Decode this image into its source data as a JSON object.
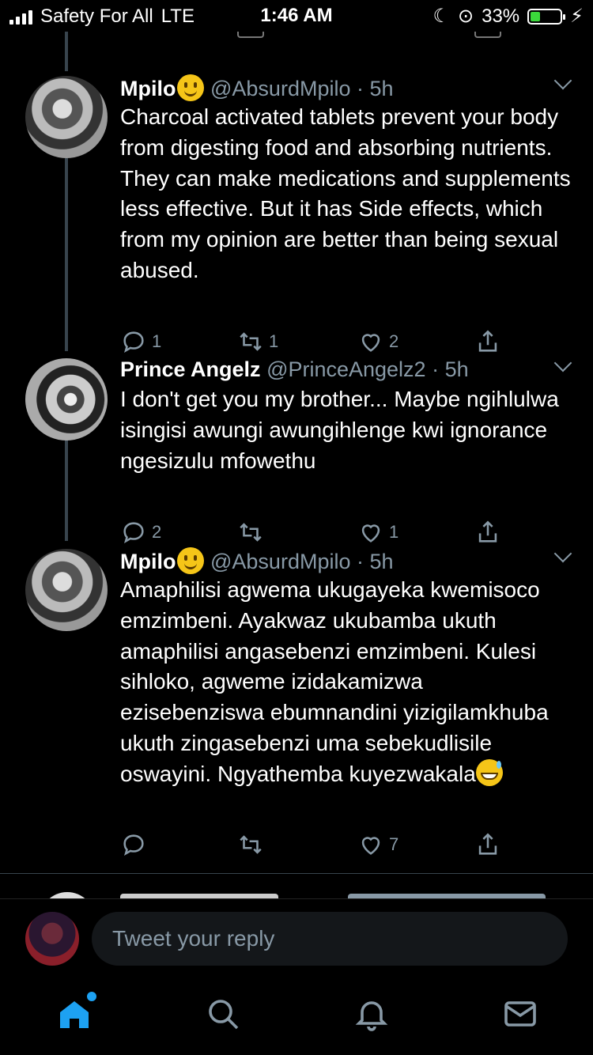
{
  "status_bar": {
    "carrier": "Safety For All",
    "network": "LTE",
    "time": "1:46 AM",
    "battery_percent": "33%",
    "battery_level": 0.33
  },
  "tweets": [
    {
      "name": "Mpilo",
      "handle": "@AbsurdMpilo",
      "dot": "·",
      "time": "5h",
      "text": "Charcoal activated tablets prevent your body from digesting food and absorbing nutrients. They can make medications and supplements less effective. But it has Side effects, which from my opinion are better than being sexual abused.",
      "replies": "1",
      "retweets": "1",
      "likes": "2"
    },
    {
      "name": "Prince Angelz",
      "handle": "@PrinceAngelz2",
      "dot": "·",
      "time": "5h",
      "text": "I don't get you my brother... Maybe ngihlulwa isingisi awungi awungihlenge kwi ignorance ngesizulu mfowethu",
      "replies": "2",
      "retweets": "",
      "likes": "1"
    },
    {
      "name": "Mpilo",
      "handle": "@AbsurdMpilo",
      "dot": "·",
      "time": "5h",
      "text": "Amaphilisi agwema ukugayeka kwemisoco emzimbeni. Ayakwaz ukubamba ukuth amaphilisi angasebenzi emzimbeni. Kulesi sihloko, agweme izidakamizwa ezisebenziswa ebumnandini yizigilamkhuba ukuth zingasebenzi uma sebekudlisile oswayini. Ngyathemba kuyezwakala",
      "replies": "",
      "retweets": "",
      "likes": "7"
    }
  ],
  "reply": {
    "placeholder": "Tweet your reply"
  },
  "tabs": [
    {
      "icon": "home-icon",
      "active": true
    },
    {
      "icon": "search-icon"
    },
    {
      "icon": "bell-icon"
    },
    {
      "icon": "mail-icon"
    }
  ],
  "colors": {
    "accent": "#1da1f2",
    "muted": "#8899a6",
    "background": "#000000"
  }
}
